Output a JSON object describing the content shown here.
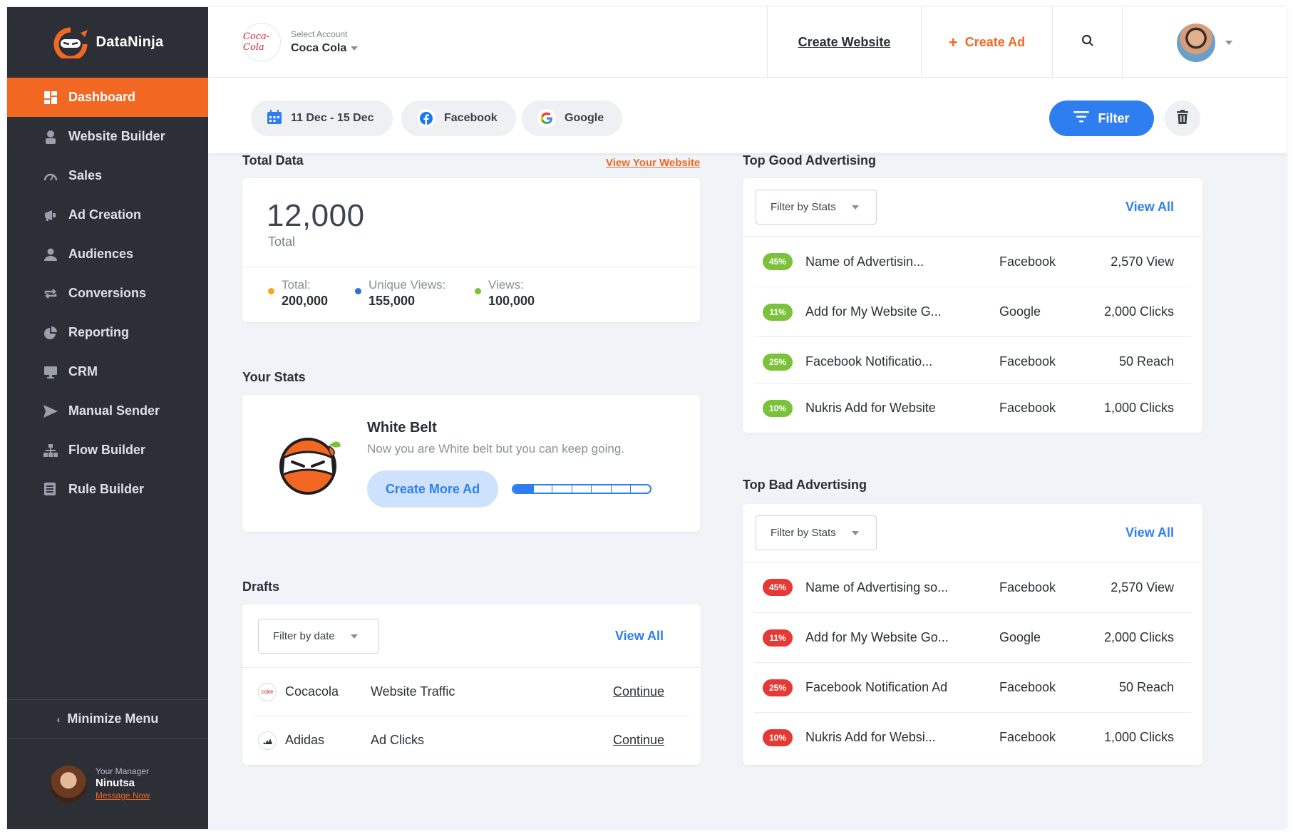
{
  "brand": {
    "name": "DataNinja"
  },
  "sidebar": {
    "items": [
      {
        "label": "Dashboard",
        "icon": "dashboard-icon"
      },
      {
        "label": "Website Builder",
        "icon": "builder-icon"
      },
      {
        "label": "Sales",
        "icon": "speedometer-icon"
      },
      {
        "label": "Ad Creation",
        "icon": "megaphone-icon"
      },
      {
        "label": "Audiences",
        "icon": "user-icon"
      },
      {
        "label": "Conversions",
        "icon": "repeat-icon"
      },
      {
        "label": "Reporting",
        "icon": "pie-icon"
      },
      {
        "label": "CRM",
        "icon": "monitor-icon"
      },
      {
        "label": "Manual Sender",
        "icon": "send-icon"
      },
      {
        "label": "Flow Builder",
        "icon": "sitemap-icon"
      },
      {
        "label": "Rule Builder",
        "icon": "list-icon"
      }
    ],
    "minimize": "Minimize Menu",
    "manager": {
      "label": "Your Manager",
      "name": "Ninutsa",
      "link": "Message Now"
    }
  },
  "header": {
    "account_label": "Select Account",
    "account_name": "Coca Cola",
    "account_logo": "Coca-Cola",
    "create_website": "Create Website",
    "create_ad": "Create Ad"
  },
  "filters": {
    "date": "11 Dec - 15 Dec",
    "facebook": "Facebook",
    "google": "Google",
    "filter_button": "Filter"
  },
  "total": {
    "title": "Total Data",
    "link": "View Your Website",
    "value": "12,000",
    "value_label": "Total",
    "stats": [
      {
        "label": "Total:",
        "value": "200,000",
        "color": "#f5a623"
      },
      {
        "label": "Unique Views:",
        "value": "155,000",
        "color": "#2f6fdf"
      },
      {
        "label": "Views:",
        "value": "100,000",
        "color": "#7bc23a"
      }
    ]
  },
  "stats": {
    "title": "Your Stats",
    "belt": "White Belt",
    "subtitle": "Now you are White belt but you can keep going.",
    "button": "Create More Ad",
    "progress": 0.15
  },
  "drafts": {
    "title": "Drafts",
    "filter": "Filter by date",
    "view_all": "View All",
    "rows": [
      {
        "name": "Cocacola",
        "type": "Website Traffic",
        "action": "Continue",
        "logo": "coke"
      },
      {
        "name": "Adidas",
        "type": "Ad Clicks",
        "action": "Continue",
        "logo": "adidas"
      }
    ]
  },
  "good": {
    "title": "Top Good Advertising",
    "filter": "Filter by Stats",
    "view_all": "View All",
    "rows": [
      {
        "pct": "45%",
        "name": "Name of Advertisin...",
        "source": "Facebook",
        "value": "2,570 View"
      },
      {
        "pct": "11%",
        "name": "Add for My Website G...",
        "source": "Google",
        "value": "2,000 Clicks"
      },
      {
        "pct": "25%",
        "name": "Facebook Notificatio...",
        "source": "Facebook",
        "value": "50 Reach"
      },
      {
        "pct": "10%",
        "name": "Nukris Add for Website",
        "source": "Facebook",
        "value": "1,000 Clicks"
      }
    ]
  },
  "bad": {
    "title": "Top Bad Advertising",
    "filter": "Filter by Stats",
    "view_all": "View All",
    "rows": [
      {
        "pct": "45%",
        "name": "Name of Advertising so...",
        "source": "Facebook",
        "value": "2,570 View"
      },
      {
        "pct": "11%",
        "name": "Add for My Website Go...",
        "source": "Google",
        "value": "2,000 Clicks"
      },
      {
        "pct": "25%",
        "name": "Facebook Notification Ad",
        "source": "Facebook",
        "value": "50 Reach"
      },
      {
        "pct": "10%",
        "name": "Nukris Add for Websi...",
        "source": "Facebook",
        "value": "1,000 Clicks"
      }
    ]
  },
  "colors": {
    "accent": "#f26722",
    "primary": "#2f7ef0",
    "sidebar": "#2c2f36",
    "good": "#7bc23a",
    "bad": "#e53935"
  }
}
